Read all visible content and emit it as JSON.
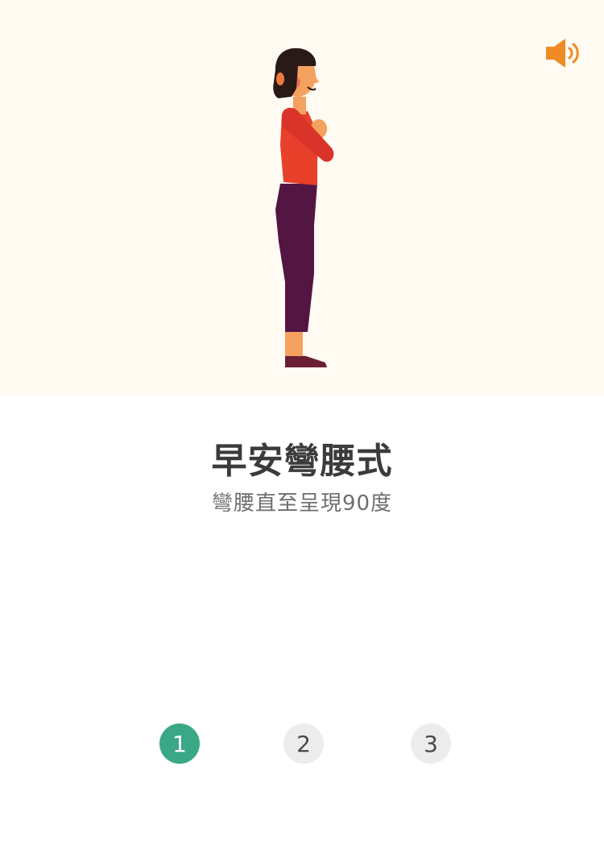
{
  "illustration": {
    "alt_icon": "woman-standing-illustration",
    "colors": {
      "background": "#fffaf2",
      "shirt": "#e8402a",
      "pants": "#531642",
      "skin": "#f5a15f",
      "hair": "#2a1a17",
      "shoes": "#6b1f35"
    }
  },
  "sound": {
    "icon": "speaker-icon",
    "color": "#f08a24"
  },
  "exercise": {
    "title": "早安彎腰式",
    "subtitle": "彎腰直至呈現90度"
  },
  "steps": [
    {
      "label": "1",
      "active": true
    },
    {
      "label": "2",
      "active": false
    },
    {
      "label": "3",
      "active": false
    }
  ],
  "colors": {
    "accent": "#3aa886",
    "inactive_step": "#ececec"
  }
}
